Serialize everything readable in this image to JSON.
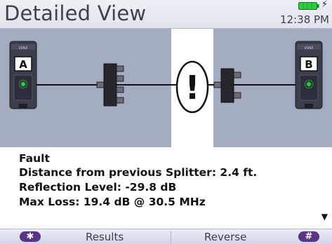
{
  "header": {
    "title": "Detailed View",
    "time": "12:38 PM",
    "battery_icon": "battery-charging-icon",
    "battery_color": "#2ecc40"
  },
  "diagram": {
    "left_device": {
      "brand": "VIAVI",
      "label": "A"
    },
    "right_device": {
      "brand": "VIAVI",
      "label": "B"
    },
    "fault_symbol": "!",
    "highlight_color": "#ffffff",
    "background_color": "#a3adbf"
  },
  "details": {
    "line1": "Fault",
    "line2": "Distance from previous Splitter:  2.4 ft.",
    "line3": "Reflection Level:  -29.8 dB",
    "line4": "Max Loss: 19.4 dB @ 30.5 MHz",
    "more_indicator": "▼"
  },
  "softkeys": {
    "left_symbol": "✱",
    "results": "Results",
    "reverse": "Reverse",
    "right_symbol": "#",
    "pill_color": "#5a3585"
  }
}
